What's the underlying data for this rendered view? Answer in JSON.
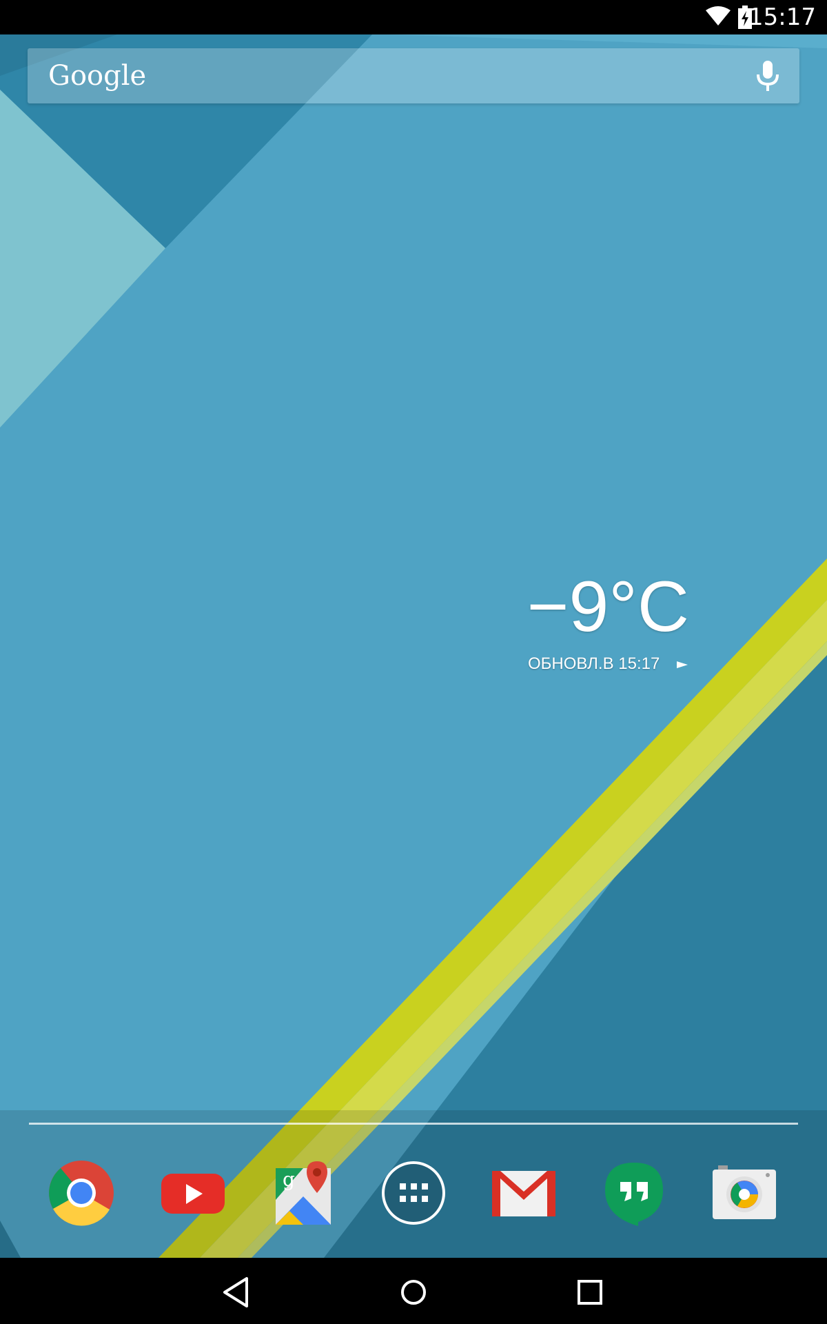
{
  "status_bar": {
    "time": "15:17",
    "icons": [
      "wifi-icon",
      "battery-charging-icon"
    ]
  },
  "search": {
    "logo_text": "Google",
    "mic_icon": "mic-icon"
  },
  "weather": {
    "temperature": "−9°C",
    "updated": "ОБНОВЛ.В 15:17",
    "arrow_icon": "play-arrow-icon"
  },
  "dock": {
    "apps": [
      {
        "name": "Chrome",
        "icon": "chrome-icon"
      },
      {
        "name": "YouTube",
        "icon": "youtube-icon"
      },
      {
        "name": "Maps",
        "icon": "maps-icon"
      },
      {
        "name": "Apps",
        "icon": "app-drawer-icon"
      },
      {
        "name": "Gmail",
        "icon": "gmail-icon"
      },
      {
        "name": "Hangouts",
        "icon": "hangouts-icon"
      },
      {
        "name": "Camera",
        "icon": "camera-icon"
      }
    ]
  },
  "navigation": {
    "buttons": [
      "back-icon",
      "home-icon",
      "recents-icon"
    ]
  },
  "colors": {
    "wallpaper_main": "#4fa3c4",
    "wallpaper_dark": "#2b7e9e",
    "wallpaper_light": "#7cc0cd",
    "stripe_yellow": "#c7cf1e"
  }
}
